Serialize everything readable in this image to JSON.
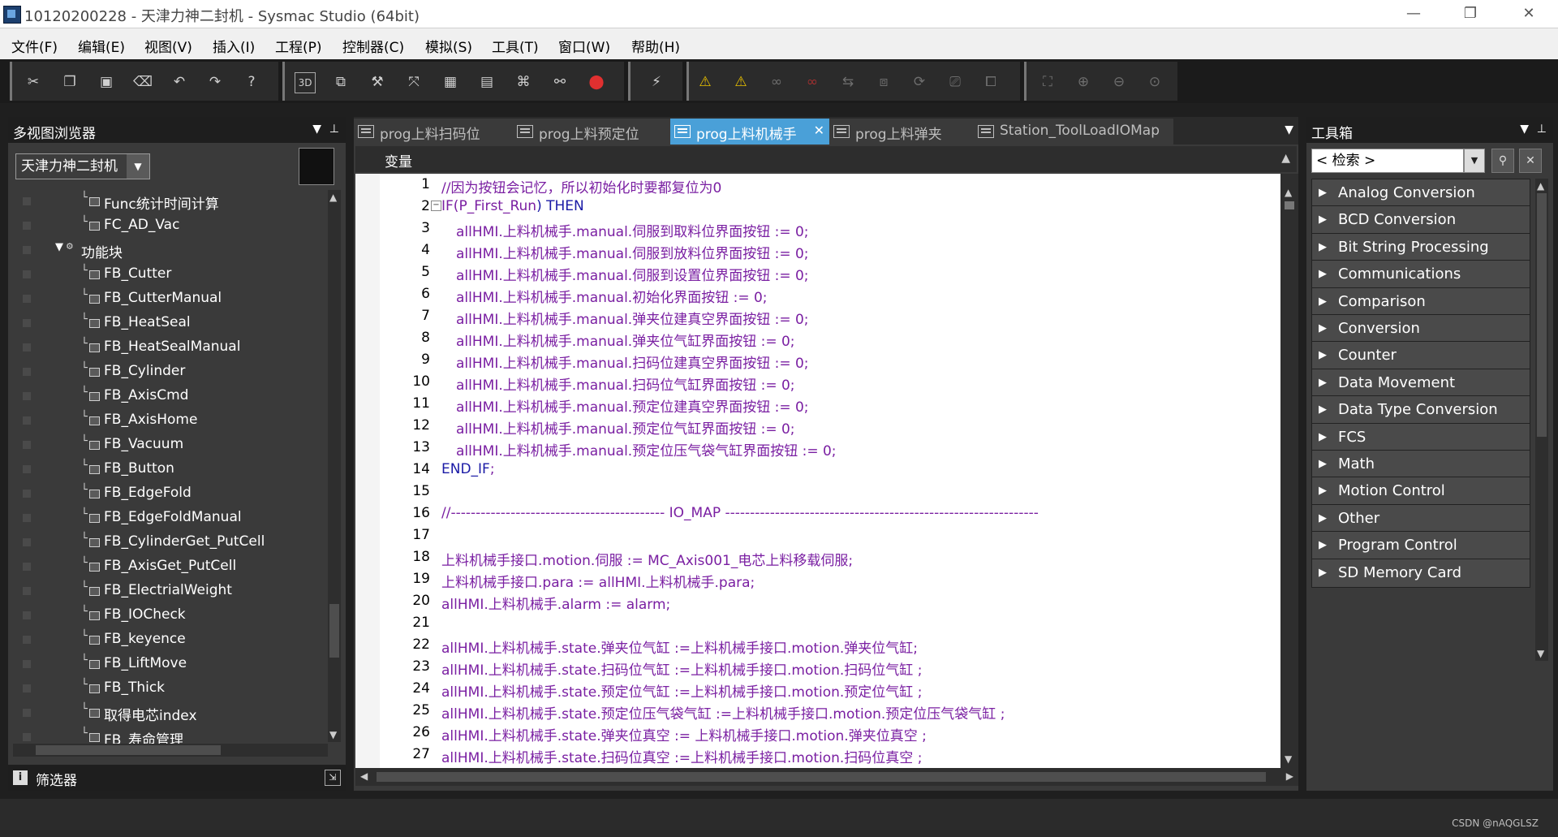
{
  "window": {
    "title": "10120200228 - 天津力神二封机 - Sysmac Studio (64bit)",
    "minimize_glyph": "—",
    "restore_glyph": "❐",
    "close_glyph": "✕"
  },
  "menu": [
    "文件(F)",
    "编辑(E)",
    "视图(V)",
    "插入(I)",
    "工程(P)",
    "控制器(C)",
    "模拟(S)",
    "工具(T)",
    "窗口(W)",
    "帮助(H)"
  ],
  "toolbar": {
    "icons": [
      "cut-icon",
      "copy-icon",
      "paste-icon",
      "delete-icon",
      "undo-icon",
      "redo-icon",
      "help-icon",
      "3d-icon",
      "window-icon",
      "build-icon",
      "crossref-icon",
      "grid-icon",
      "table-icon",
      "network-icon",
      "binoculars-icon",
      "error-icon",
      "wand-icon",
      "warning-icon",
      "warning-off-icon",
      "online-icon",
      "offline-icon",
      "transfer-icon",
      "compare-icon",
      "sync-icon",
      "monitor-icon",
      "layout-icon",
      "fit-icon",
      "zoom-in-icon",
      "zoom-out-icon",
      "zoom-reset-icon"
    ],
    "label_3d": "3D"
  },
  "left_panel": {
    "title": "多视图浏览器",
    "project_dropdown": "天津力神二封机",
    "items": [
      {
        "label": "Func统计时间计算",
        "type": "leaf"
      },
      {
        "label": "FC_AD_Vac",
        "type": "leaf"
      },
      {
        "label": "功能块",
        "type": "folder"
      },
      {
        "label": "FB_Cutter",
        "type": "leaf"
      },
      {
        "label": "FB_CutterManual",
        "type": "leaf"
      },
      {
        "label": "FB_HeatSeal",
        "type": "leaf"
      },
      {
        "label": "FB_HeatSealManual",
        "type": "leaf"
      },
      {
        "label": "FB_Cylinder",
        "type": "leaf"
      },
      {
        "label": "FB_AxisCmd",
        "type": "leaf"
      },
      {
        "label": "FB_AxisHome",
        "type": "leaf"
      },
      {
        "label": "FB_Vacuum",
        "type": "leaf"
      },
      {
        "label": "FB_Button",
        "type": "leaf"
      },
      {
        "label": "FB_EdgeFold",
        "type": "leaf"
      },
      {
        "label": "FB_EdgeFoldManual",
        "type": "leaf"
      },
      {
        "label": "FB_CylinderGet_PutCell",
        "type": "leaf"
      },
      {
        "label": "FB_AxisGet_PutCell",
        "type": "leaf"
      },
      {
        "label": "FB_ElectrialWeight",
        "type": "leaf"
      },
      {
        "label": "FB_IOCheck",
        "type": "leaf"
      },
      {
        "label": "FB_keyence",
        "type": "leaf"
      },
      {
        "label": "FB_LiftMove",
        "type": "leaf"
      },
      {
        "label": "FB_Thick",
        "type": "leaf"
      },
      {
        "label": "取得电芯index",
        "type": "leaf"
      },
      {
        "label": "FB_寿命管理",
        "type": "leaf"
      }
    ],
    "filter_label": "筛选器"
  },
  "editor": {
    "tabs": [
      {
        "label": "prog上料扫码位",
        "active": false
      },
      {
        "label": "prog上料预定位",
        "active": false
      },
      {
        "label": "prog上料机械手",
        "active": true
      },
      {
        "label": "prog上料弹夹",
        "active": false
      },
      {
        "label": "Station_ToolLoadIOMap",
        "active": false
      }
    ],
    "variables_label": "变量",
    "lines": [
      {
        "n": "1",
        "indent": 0,
        "parts": [
          {
            "t": "//因为按钮会记忆，所以初始化时要都复位为0",
            "c": "comment"
          }
        ]
      },
      {
        "n": "2",
        "indent": 0,
        "fold": true,
        "parts": [
          {
            "t": "IF(",
            "c": "var"
          },
          {
            "t": "P_First_Run",
            "c": "var"
          },
          {
            "t": ") THEN",
            "c": "kw"
          }
        ]
      },
      {
        "n": "3",
        "indent": 1,
        "parts": [
          {
            "t": "allHMI.上料机械手.manual.伺服到取料位界面按钮 := 0;",
            "c": "var"
          }
        ]
      },
      {
        "n": "4",
        "indent": 1,
        "parts": [
          {
            "t": "allHMI.上料机械手.manual.伺服到放料位界面按钮 := 0;",
            "c": "var"
          }
        ]
      },
      {
        "n": "5",
        "indent": 1,
        "parts": [
          {
            "t": "allHMI.上料机械手.manual.伺服到设置位界面按钮 := 0;",
            "c": "var"
          }
        ]
      },
      {
        "n": "6",
        "indent": 1,
        "parts": [
          {
            "t": "allHMI.上料机械手.manual.初始化界面按钮 := 0;",
            "c": "var"
          }
        ]
      },
      {
        "n": "7",
        "indent": 1,
        "parts": [
          {
            "t": "allHMI.上料机械手.manual.弹夹位建真空界面按钮 := 0;",
            "c": "var"
          }
        ]
      },
      {
        "n": "8",
        "indent": 1,
        "parts": [
          {
            "t": "allHMI.上料机械手.manual.弹夹位气缸界面按钮 := 0;",
            "c": "var"
          }
        ]
      },
      {
        "n": "9",
        "indent": 1,
        "parts": [
          {
            "t": "allHMI.上料机械手.manual.扫码位建真空界面按钮 := 0;",
            "c": "var"
          }
        ]
      },
      {
        "n": "10",
        "indent": 1,
        "parts": [
          {
            "t": "allHMI.上料机械手.manual.扫码位气缸界面按钮 := 0;",
            "c": "var"
          }
        ]
      },
      {
        "n": "11",
        "indent": 1,
        "parts": [
          {
            "t": "allHMI.上料机械手.manual.预定位建真空界面按钮 := 0;",
            "c": "var"
          }
        ]
      },
      {
        "n": "12",
        "indent": 1,
        "parts": [
          {
            "t": "allHMI.上料机械手.manual.预定位气缸界面按钮 := 0;",
            "c": "var"
          }
        ]
      },
      {
        "n": "13",
        "indent": 1,
        "parts": [
          {
            "t": "allHMI.上料机械手.manual.预定位压气袋气缸界面按钮 := 0;",
            "c": "var"
          }
        ]
      },
      {
        "n": "14",
        "indent": 0,
        "parts": [
          {
            "t": "END_IF",
            "c": "kw"
          },
          {
            "t": ";",
            "c": "var"
          }
        ]
      },
      {
        "n": "15",
        "indent": 0,
        "parts": []
      },
      {
        "n": "16",
        "indent": 0,
        "parts": [
          {
            "t": "//------------------------------------------- IO_MAP ---------------------------------------------------------------",
            "c": "comment"
          }
        ]
      },
      {
        "n": "17",
        "indent": 0,
        "parts": []
      },
      {
        "n": "18",
        "indent": 0,
        "parts": [
          {
            "t": "上料机械手接口.motion.伺服 := MC_Axis001_电芯上料移载伺服;",
            "c": "var"
          }
        ]
      },
      {
        "n": "19",
        "indent": 0,
        "parts": [
          {
            "t": "上料机械手接口.para := allHMI.上料机械手.para;",
            "c": "var"
          }
        ]
      },
      {
        "n": "20",
        "indent": 0,
        "parts": [
          {
            "t": "allHMI.上料机械手.alarm := alarm;",
            "c": "var"
          }
        ]
      },
      {
        "n": "21",
        "indent": 0,
        "parts": []
      },
      {
        "n": "22",
        "indent": 0,
        "parts": [
          {
            "t": "allHMI.上料机械手.state.弹夹位气缸 :=上料机械手接口.motion.弹夹位气缸;",
            "c": "var"
          }
        ]
      },
      {
        "n": "23",
        "indent": 0,
        "parts": [
          {
            "t": "allHMI.上料机械手.state.扫码位气缸 :=上料机械手接口.motion.扫码位气缸 ;",
            "c": "var"
          }
        ]
      },
      {
        "n": "24",
        "indent": 0,
        "parts": [
          {
            "t": "allHMI.上料机械手.state.预定位气缸 :=上料机械手接口.motion.预定位气缸 ;",
            "c": "var"
          }
        ]
      },
      {
        "n": "25",
        "indent": 0,
        "parts": [
          {
            "t": "allHMI.上料机械手.state.预定位压气袋气缸 :=上料机械手接口.motion.预定位压气袋气缸 ;",
            "c": "var"
          }
        ]
      },
      {
        "n": "26",
        "indent": 0,
        "parts": [
          {
            "t": "allHMI.上料机械手.state.弹夹位真空 := 上料机械手接口.motion.弹夹位真空 ;",
            "c": "var"
          }
        ]
      },
      {
        "n": "27",
        "indent": 0,
        "parts": [
          {
            "t": "allHMI.上料机械手.state.扫码位真空 :=上料机械手接口.motion.扫码位真空 ;",
            "c": "var"
          }
        ]
      }
    ]
  },
  "toolbox": {
    "title": "工具箱",
    "search_placeholder": "< 检索 >",
    "items": [
      "Analog Conversion",
      "BCD Conversion",
      "Bit String Processing",
      "Communications",
      "Comparison",
      "Conversion",
      "Counter",
      "Data Movement",
      "Data Type Conversion",
      "FCS",
      "Math",
      "Motion Control",
      "Other",
      "Program Control",
      "SD Memory Card"
    ]
  },
  "status": {
    "watermark": "CSDN @nAQGLSZ"
  },
  "colors": {
    "active_tab": "#4aa0d8",
    "comment": "#7a1fa2",
    "keyword": "#1a1aa6",
    "panel_bg": "#3a3a3a"
  }
}
